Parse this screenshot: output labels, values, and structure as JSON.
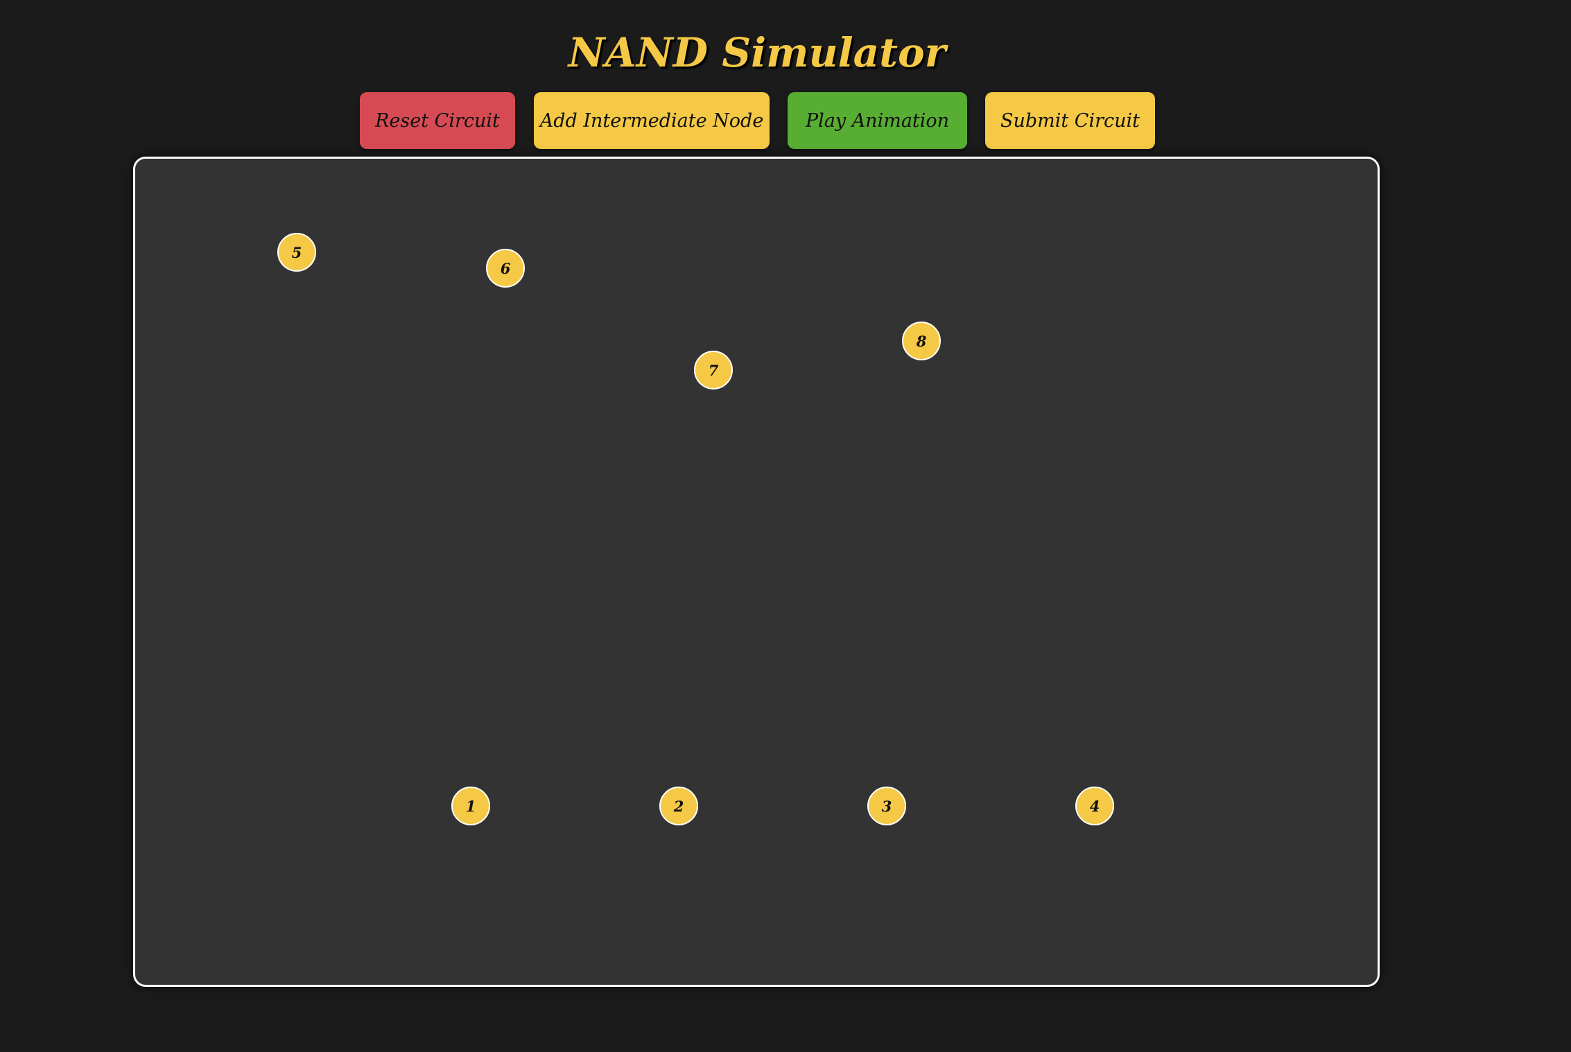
{
  "header": {
    "title": "NAND Simulator"
  },
  "toolbar": {
    "reset_label": "Reset Circuit",
    "add_node_label": "Add Intermediate Node",
    "play_label": "Play Animation",
    "submit_label": "Submit Circuit"
  },
  "colors": {
    "background": "#1b1b1b",
    "canvas": "#333333",
    "accent_yellow": "#f5c945",
    "reset_red": "#d64b53",
    "play_green": "#58ad33"
  },
  "circuit": {
    "nodes": [
      {
        "label": "1"
      },
      {
        "label": "2"
      },
      {
        "label": "3"
      },
      {
        "label": "4"
      },
      {
        "label": "5"
      },
      {
        "label": "6"
      },
      {
        "label": "7"
      },
      {
        "label": "8"
      }
    ]
  }
}
